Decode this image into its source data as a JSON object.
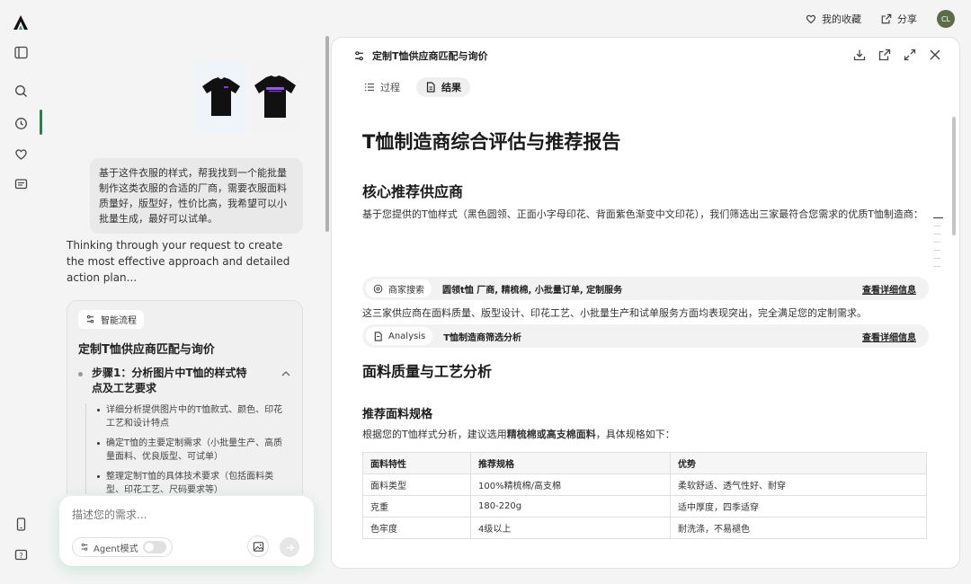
{
  "header": {
    "favorites_label": "我的收藏",
    "share_label": "分享",
    "avatar_initials": "CL"
  },
  "chat": {
    "user_message": "基于这件衣服的样式，帮我找到一个能批量制作这类衣服的合适的厂商，需要衣服面料质量好，版型好，性价比高，我希望可以小批量生成，最好可以试单。",
    "thinking_text": "Thinking through your request to create the most effective approach and detailed action plan...",
    "flow": {
      "tag": "智能流程",
      "title": "定制T恤供应商匹配与询价",
      "step_title": "步骤1：分析图片中T恤的样式特点及工艺要求",
      "substeps": [
        "详细分析提供图片中的T恤款式、颜色、印花工艺和设计特点",
        "确定T恤的主要定制需求（小批量生产、高质量面料、优良版型、可试单）",
        "整理定制T恤的具体技术要求（包括面料类型、印花工艺、尺码要求等）"
      ]
    },
    "input": {
      "placeholder": "描述您的需求...",
      "agent_label": "Agent模式"
    }
  },
  "panel": {
    "title": "定制T恤供应商匹配与询价",
    "tabs": [
      "过程",
      "结果"
    ],
    "active_tab": 1,
    "doc": {
      "h1": "T恤制造商综合评估与推荐报告",
      "section1_title": "核心推荐供应商",
      "section1_intro": "基于您提供的T恤样式（黑色圆领、正面小字母印花、背面紫色渐变中文印花），我们筛选出三家最符合您需求的优质T恤制造商：",
      "tool1": {
        "name": "商家搜索",
        "query": "圆领t恤 厂商, 精梳棉, 小批量订单, 定制服务",
        "link": "查看详细信息"
      },
      "section1_summary": "这三家供应商在面料质量、版型设计、印花工艺、小批量生产和试单服务方面均表现突出，完全满足您的定制需求。",
      "tool2": {
        "name": "Analysis",
        "query": "T恤制造商筛选分析",
        "link": "查看详细信息"
      },
      "section2_title": "面料质量与工艺分析",
      "section3_title": "推荐面料规格",
      "section3_intro_prefix": "根据您的T恤样式分析，建议选用",
      "section3_intro_bold": "精梳棉或高支棉面料",
      "section3_intro_suffix": "，具体规格如下：",
      "table": {
        "headers": [
          "面料特性",
          "推荐规格",
          "优势"
        ],
        "rows": [
          [
            "面料类型",
            "100%精梳棉/高支棉",
            "柔软舒适、透气性好、耐穿"
          ],
          [
            "克重",
            "180-220g",
            "适中厚度，四季适穿"
          ],
          [
            "色牢度",
            "4级以上",
            "耐洗涤，不易褪色"
          ]
        ]
      }
    }
  },
  "colors": {
    "accent": "#2e7d4f",
    "avatar_bg": "#5c6b4a",
    "print_purple": "#7b3fd0"
  }
}
